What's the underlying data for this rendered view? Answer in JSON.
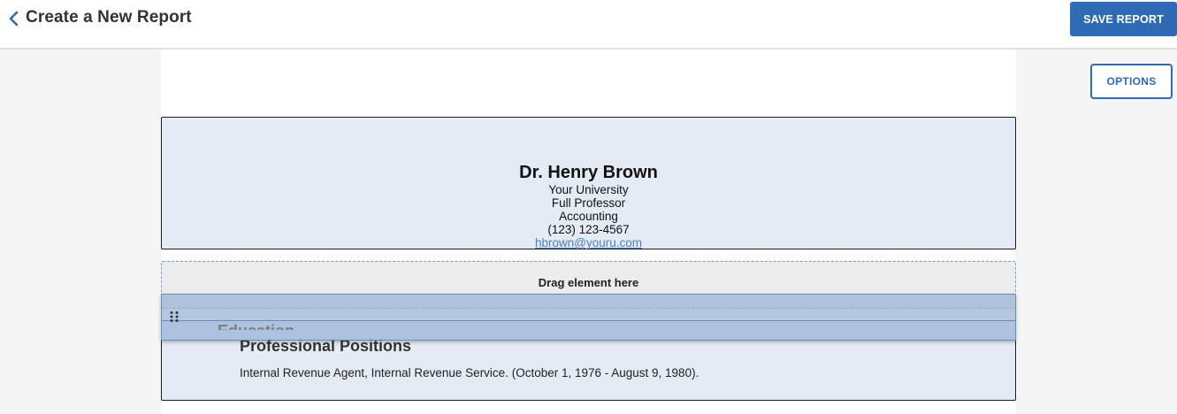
{
  "header": {
    "title": "Create a New Report",
    "back_icon": "chevron-left-icon",
    "save_label": "SAVE REPORT"
  },
  "options_label": "OPTIONS",
  "report_header": {
    "name": "Dr. Henry Brown",
    "institution": "Your University",
    "position": "Full Professor",
    "department": "Accounting",
    "phone": "(123) 123-4567",
    "email": "hbrown@youru.com"
  },
  "dropzone": {
    "label": "Drag element here"
  },
  "dragging_element": {
    "title": "Education",
    "handle_icon": "drag-handle-icon"
  },
  "section": {
    "heading": "Professional Positions",
    "entries": [
      "Internal Revenue Agent, Internal Revenue Service. (October 1, 1976 - August 9, 1980)."
    ]
  },
  "colors": {
    "accent": "#2f6ab4",
    "block_bg": "#e4ebf4",
    "link": "#4a7fc1",
    "ghost": "#96b2d6"
  }
}
